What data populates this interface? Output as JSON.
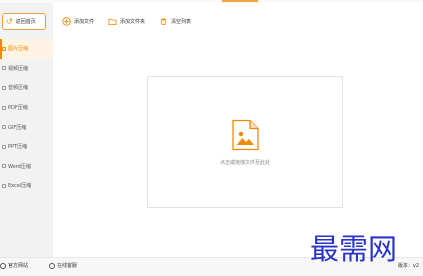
{
  "colors": {
    "accent": "#f08a00",
    "sidebar_bg": "#f2f2f2",
    "watermark": "#2a33c8"
  },
  "sidebar": {
    "back_label": "返回首页",
    "items": [
      {
        "label": "图片压缩",
        "active": true
      },
      {
        "label": "视频压缩",
        "active": false
      },
      {
        "label": "音频压缩",
        "active": false
      },
      {
        "label": "PDF压缩",
        "active": false
      },
      {
        "label": "GIF压缩",
        "active": false
      },
      {
        "label": "PPT压缩",
        "active": false
      },
      {
        "label": "Word压缩",
        "active": false
      },
      {
        "label": "Excel压缩",
        "active": false
      }
    ]
  },
  "toolbar": {
    "add_file": "添加文件",
    "add_folder": "添加文件夹",
    "clear_list": "清空列表"
  },
  "dropzone": {
    "hint": "点击或拖拽文件至此处"
  },
  "footer": {
    "website": "官方网站",
    "help": "在线客服",
    "version": "版本：v2"
  },
  "watermark": "最需网"
}
